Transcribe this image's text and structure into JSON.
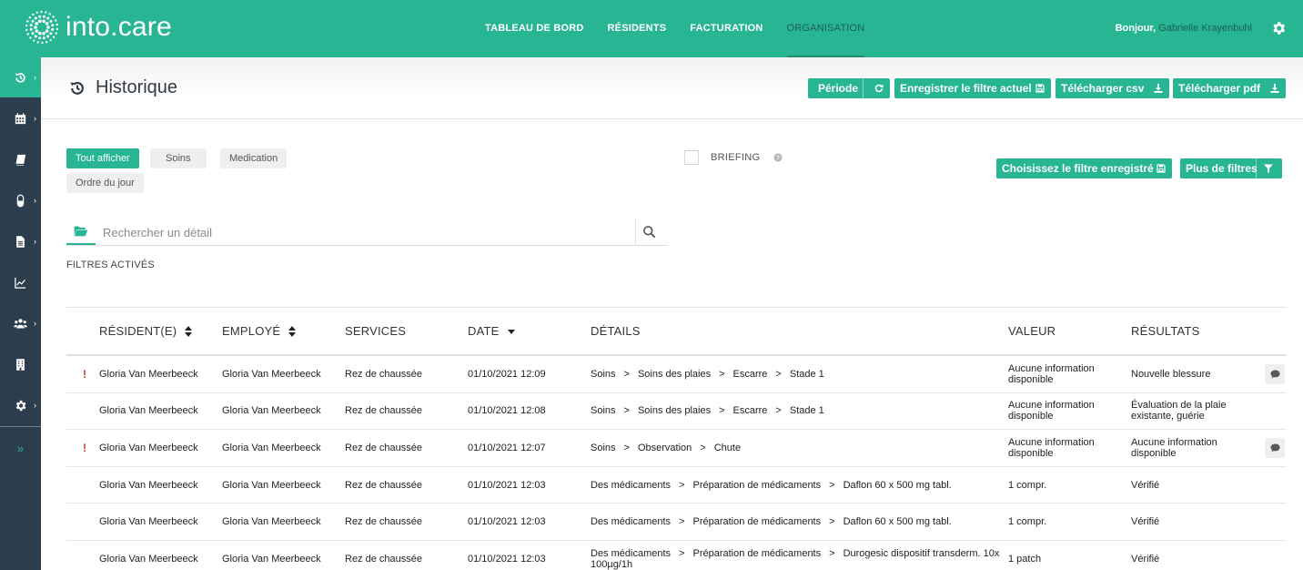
{
  "brand": {
    "name": "into.care",
    "accent": "#27b594",
    "sidebar_bg": "#2c3e4e"
  },
  "nav": {
    "items": [
      {
        "label": "TABLEAU DE BORD",
        "active": false
      },
      {
        "label": "RÉSIDENTS",
        "active": false
      },
      {
        "label": "FACTURATION",
        "active": false
      },
      {
        "label": "ORGANISATION",
        "active": true
      }
    ]
  },
  "user": {
    "greeting": "Bonjour,",
    "name": "Gabrielle Krayenbuhl"
  },
  "sidebar": {
    "items": [
      {
        "icon": "history-icon",
        "active": true,
        "chevron": "›"
      },
      {
        "icon": "calendar-icon",
        "active": false,
        "chevron": "›"
      },
      {
        "icon": "book-icon",
        "active": false,
        "chevron": ""
      },
      {
        "icon": "pill-icon",
        "active": false,
        "chevron": "›"
      },
      {
        "icon": "document-icon",
        "active": false,
        "chevron": "›"
      },
      {
        "icon": "chart-icon",
        "active": false,
        "chevron": ""
      },
      {
        "icon": "users-icon",
        "active": false,
        "chevron": "›"
      },
      {
        "icon": "building-icon",
        "active": false,
        "chevron": ""
      },
      {
        "icon": "gear-icon",
        "active": false,
        "chevron": "›"
      }
    ],
    "expand": "»"
  },
  "page": {
    "title": "Historique"
  },
  "toolbar": {
    "periode": "Période",
    "save_filter": "Enregistrer le filtre actuel",
    "download_csv": "Télécharger csv",
    "download_pdf": "Télécharger pdf",
    "choose_filter": "Choisissez le filtre enregistré",
    "more_filters": "Plus de filtres"
  },
  "chips": [
    {
      "label": "Tout afficher",
      "active": true
    },
    {
      "label": "Soins",
      "active": false
    },
    {
      "label": "Medication",
      "active": false
    },
    {
      "label": "Ordre du jour",
      "active": false
    }
  ],
  "briefing": {
    "label": "BRIEFING",
    "checked": false
  },
  "search": {
    "placeholder": "Rechercher un détail",
    "value": ""
  },
  "filters_label": "FILTRES ACTIVÉS",
  "table": {
    "columns": {
      "resident": "RÉSIDENT(E)",
      "employee": "EMPLOYÉ",
      "services": "SERVICES",
      "date": "DATE",
      "details": "DÉTAILS",
      "value": "VALEUR",
      "results": "RÉSULTATS"
    },
    "rows": [
      {
        "flag": "!",
        "resident": "Gloria Van Meerbeeck",
        "employee": "Gloria Van Meerbeeck",
        "services": "Rez de chaussée",
        "date": "01/10/2021 12:09",
        "details": [
          "Soins",
          "Soins des plaies",
          "Escarre",
          "Stade 1"
        ],
        "value": "Aucune information disponible",
        "results": "Nouvelle blessure",
        "comment": true
      },
      {
        "flag": "",
        "resident": "Gloria Van Meerbeeck",
        "employee": "Gloria Van Meerbeeck",
        "services": "Rez de chaussée",
        "date": "01/10/2021 12:08",
        "details": [
          "Soins",
          "Soins des plaies",
          "Escarre",
          "Stade 1"
        ],
        "value": "Aucune information disponible",
        "results": "Évaluation de la plaie existante, guérie",
        "comment": false
      },
      {
        "flag": "!",
        "resident": "Gloria Van Meerbeeck",
        "employee": "Gloria Van Meerbeeck",
        "services": "Rez de chaussée",
        "date": "01/10/2021 12:07",
        "details": [
          "Soins",
          "Observation",
          "Chute"
        ],
        "value": "Aucune information disponible",
        "results": "Aucune information disponible",
        "comment": true
      },
      {
        "flag": "",
        "resident": "Gloria Van Meerbeeck",
        "employee": "Gloria Van Meerbeeck",
        "services": "Rez de chaussée",
        "date": "01/10/2021 12:03",
        "details": [
          "Des médicaments",
          "Préparation de médicaments",
          "Daflon 60 x 500 mg tabl."
        ],
        "value": "1 compr.",
        "results": "Vérifié",
        "comment": false
      },
      {
        "flag": "",
        "resident": "Gloria Van Meerbeeck",
        "employee": "Gloria Van Meerbeeck",
        "services": "Rez de chaussée",
        "date": "01/10/2021 12:03",
        "details": [
          "Des médicaments",
          "Préparation de médicaments",
          "Daflon 60 x 500 mg tabl."
        ],
        "value": "1 compr.",
        "results": "Vérifié",
        "comment": false
      },
      {
        "flag": "",
        "resident": "Gloria Van Meerbeeck",
        "employee": "Gloria Van Meerbeeck",
        "services": "Rez de chaussée",
        "date": "01/10/2021 12:03",
        "details": [
          "Des médicaments",
          "Préparation de médicaments",
          "Durogesic dispositif transderm. 10x 100µg/1h"
        ],
        "value": "1 patch",
        "results": "Vérifié",
        "comment": false
      }
    ]
  }
}
